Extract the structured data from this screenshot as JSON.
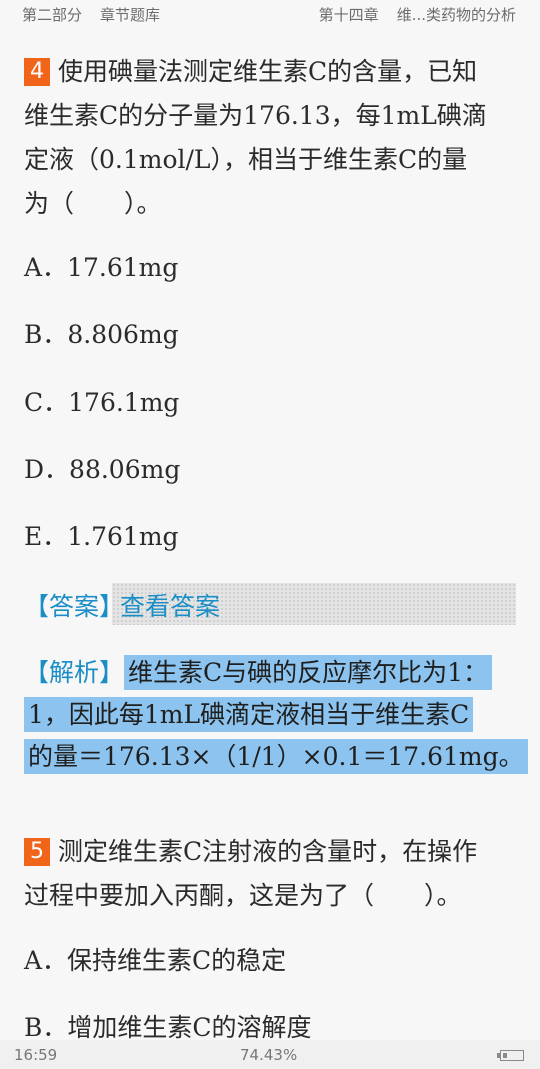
{
  "header": {
    "section": "第二部分",
    "category": "章节题库",
    "chapter": "第十四章",
    "chapter_title": "维...类药物的分析"
  },
  "question4": {
    "number": "4",
    "lines": [
      "使用碘量法测定维生素C的含量，已知",
      "维生素C的分子量为176.13，每1mL碘滴",
      "定液（0.1mol/L），相当于维生素C的量",
      "为（　　）。"
    ],
    "options": [
      "A．17.61mg",
      "B．8.806mg",
      "C．176.1mg",
      "D．88.06mg",
      "E．1.761mg"
    ],
    "answer_label": "【答案】",
    "answer_link": "查看答案",
    "analysis_label": "【解析】",
    "analysis_lines": [
      "维生素C与碘的反应摩尔比为1：",
      "1，因此每1mL碘滴定液相当于维生素C",
      "的量＝176.13×（1/1）×0.1＝17.61mg。"
    ]
  },
  "question5": {
    "number": "5",
    "lines": [
      "测定维生素C注射液的含量时，在操作",
      "过程中要加入丙酮，这是为了（　　）。"
    ],
    "options": [
      "A．保持维生素C的稳定",
      "B．增加维生素C的溶解度"
    ]
  },
  "status": {
    "time": "16:59",
    "progress": "74.43%",
    "battery_level": 0.2
  },
  "colors": {
    "accent": "#f0651a",
    "link": "#1b8ec7",
    "highlight": "#8cc4ef"
  }
}
